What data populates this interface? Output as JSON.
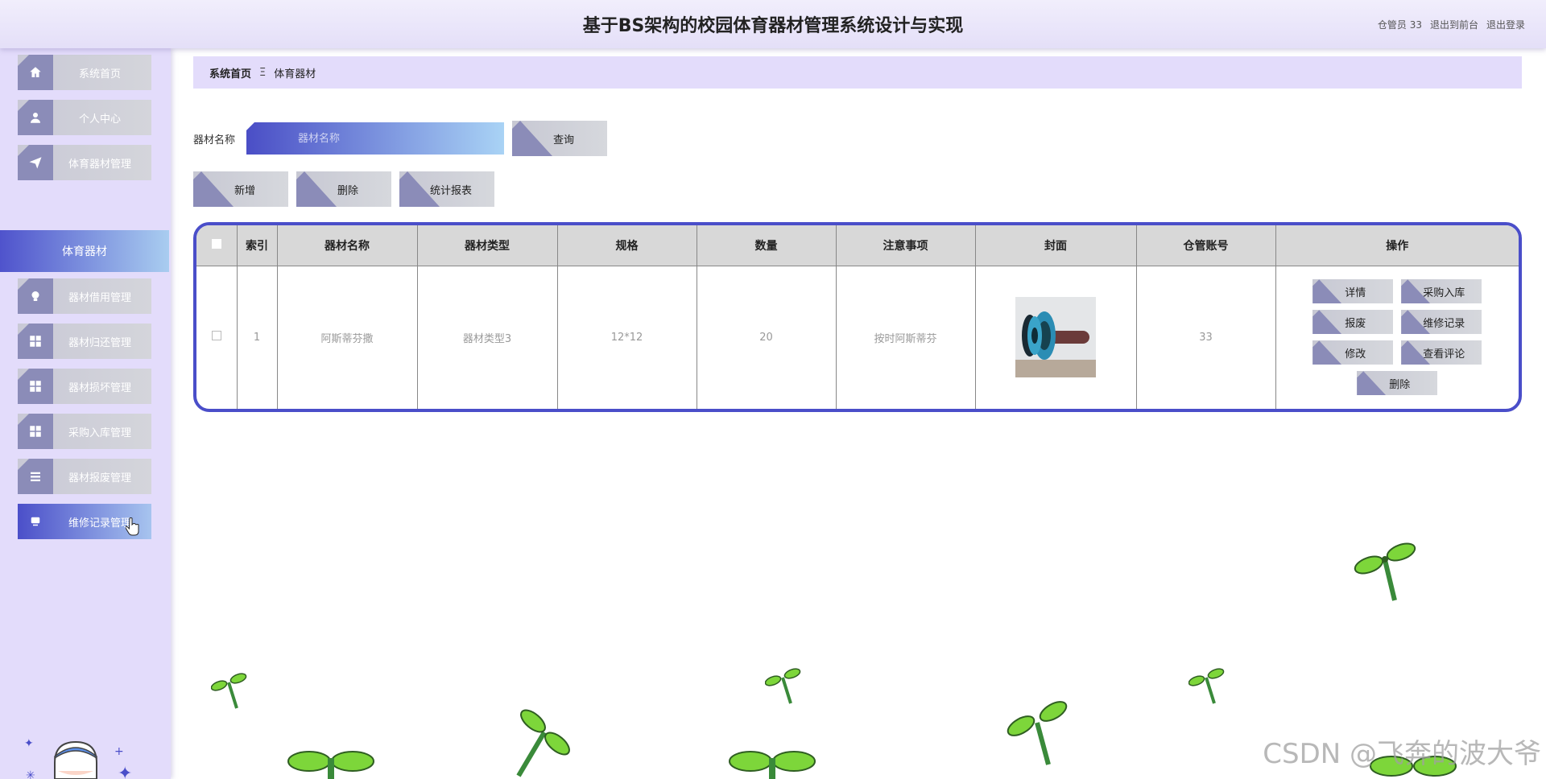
{
  "header": {
    "title": "基于BS架构的校园体育器材管理系统设计与实现",
    "user_role": "仓管员 33",
    "to_front": "退出到前台",
    "logout": "退出登录"
  },
  "sidebar": {
    "items": [
      {
        "label": "系统首页",
        "icon": "home-icon"
      },
      {
        "label": "个人中心",
        "icon": "user-icon"
      },
      {
        "label": "体育器材管理",
        "icon": "send-icon"
      },
      {
        "label": "器材借用管理",
        "icon": "bulb-icon"
      },
      {
        "label": "器材归还管理",
        "icon": "grid-icon"
      },
      {
        "label": "器材损坏管理",
        "icon": "grid-icon"
      },
      {
        "label": "采购入库管理",
        "icon": "grid-icon"
      },
      {
        "label": "器材报废管理",
        "icon": "list-icon"
      },
      {
        "label": "维修记录管理",
        "icon": "monitor-icon"
      }
    ],
    "submenu": "体育器材"
  },
  "breadcrumb": {
    "home": "系统首页",
    "sep": "Ξ",
    "current": "体育器材"
  },
  "search": {
    "label": "器材名称",
    "placeholder": "器材名称",
    "button": "查询"
  },
  "actions": {
    "add": "新增",
    "delete": "删除",
    "report": "统计报表"
  },
  "table": {
    "headers": [
      "索引",
      "器材名称",
      "器材类型",
      "规格",
      "数量",
      "注意事项",
      "封面",
      "仓管账号",
      "操作"
    ],
    "rows": [
      {
        "index": "1",
        "name": "阿斯蒂芬撒",
        "type": "器材类型3",
        "spec": "12*12",
        "qty": "20",
        "note": "按时阿斯蒂芬",
        "account": "33",
        "ops": [
          "详情",
          "采购入库",
          "报废",
          "维修记录",
          "修改",
          "查看评论",
          "删除"
        ]
      }
    ]
  },
  "watermark": "CSDN @飞奔的波大爷",
  "colors": {
    "accent": "#4a4ec9",
    "sidebar_bg": "#e3dcfb",
    "button_corner": "#8b8cb8"
  }
}
